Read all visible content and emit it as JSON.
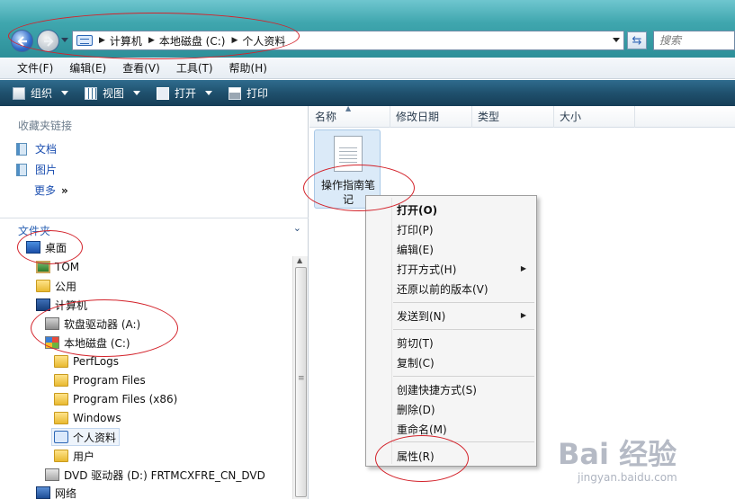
{
  "address": {
    "crumbs": [
      "计算机",
      "本地磁盘 (C:)",
      "个人资料"
    ],
    "search_placeholder": "搜索"
  },
  "menubar": {
    "items": [
      "文件(F)",
      "编辑(E)",
      "查看(V)",
      "工具(T)",
      "帮助(H)"
    ]
  },
  "commandbar": {
    "organize": "组织",
    "views": "视图",
    "open": "打开",
    "print": "打印"
  },
  "navpane": {
    "favorites_title": "收藏夹链接",
    "favorites": [
      "文档",
      "图片",
      "更多"
    ],
    "more_arrows": "»",
    "folders_title": "文件夹",
    "tree": [
      {
        "label": "桌面",
        "icon": "desktop-icon"
      },
      {
        "label": "TOM",
        "icon": "user-folder-icon"
      },
      {
        "label": "公用",
        "icon": "folder-icon"
      },
      {
        "label": "计算机",
        "icon": "computer-icon"
      },
      {
        "label": "软盘驱动器 (A:)",
        "icon": "floppy-drive-icon"
      },
      {
        "label": "本地磁盘 (C:)",
        "icon": "local-disk-icon"
      },
      {
        "label": "PerfLogs",
        "icon": "folder-icon"
      },
      {
        "label": "Program Files",
        "icon": "folder-icon"
      },
      {
        "label": "Program Files (x86)",
        "icon": "folder-icon"
      },
      {
        "label": "Windows",
        "icon": "folder-icon"
      },
      {
        "label": "个人资料",
        "icon": "library-folder-icon"
      },
      {
        "label": "用户",
        "icon": "folder-icon"
      },
      {
        "label": "DVD 驱动器 (D:) FRTMCXFRE_CN_DVD",
        "icon": "dvd-drive-icon"
      },
      {
        "label": "网络",
        "icon": "network-icon"
      }
    ]
  },
  "columns": [
    "名称",
    "修改日期",
    "类型",
    "大小"
  ],
  "file": {
    "name_line1": "操作指南笔",
    "name_line2": "记"
  },
  "context_menu": {
    "group1": [
      "打开(O)",
      "打印(P)",
      "编辑(E)",
      "打开方式(H)",
      "还原以前的版本(V)"
    ],
    "group2": [
      "发送到(N)"
    ],
    "group3": [
      "剪切(T)",
      "复制(C)"
    ],
    "group4": [
      "创建快捷方式(S)",
      "删除(D)",
      "重命名(M)"
    ],
    "group5": [
      "属性(R)"
    ]
  },
  "watermark": {
    "logo": "Bai 经验",
    "sub": "jingyan.baidu.com"
  },
  "colors": {
    "annotation": "#d3232b",
    "link": "#1c4fb0",
    "commandbar": "#1f506d"
  }
}
